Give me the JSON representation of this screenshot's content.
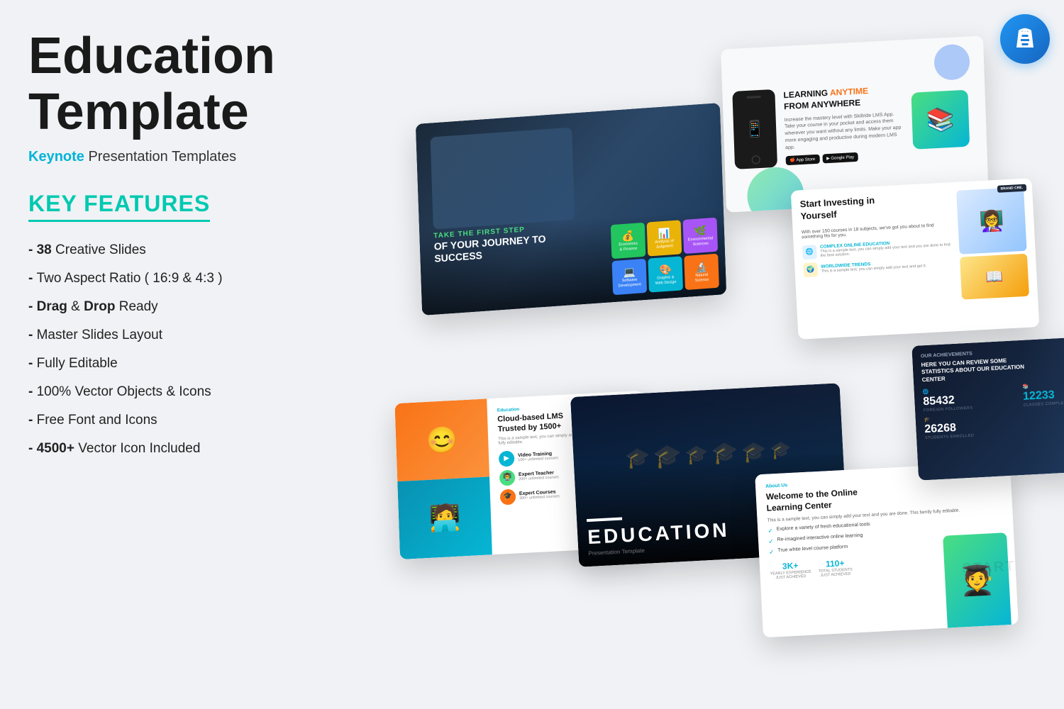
{
  "page": {
    "background": "#eef0f4",
    "title": "Education Template",
    "subtitle_prefix": "Keynote",
    "subtitle_suffix": " Presentation Templates",
    "features_heading": "KEY FEATURES",
    "features": [
      {
        "bold_part": "38",
        "rest": " Creative Slides"
      },
      {
        "bold_part": "",
        "rest": "Two Aspect Ratio ( 16:9 & 4:3 )"
      },
      {
        "bold_part": "Drag",
        "rest": " & ",
        "bold2": "Drop",
        "rest2": " Ready"
      },
      {
        "bold_part": "",
        "rest": "Master Slides Layout"
      },
      {
        "bold_part": "",
        "rest": "Fully Editable"
      },
      {
        "bold_part": "",
        "rest": "100% Vector Objects & Icons"
      },
      {
        "bold_part": "",
        "rest": "Free Font and Icons"
      },
      {
        "bold_part": "4500+",
        "rest": " Vector Icon Included"
      }
    ]
  },
  "slides": {
    "slide1": {
      "tagline": "TAKE THE FIRST STEP",
      "main": "OF YOUR JOURNEY TO SUCCESS",
      "boxes": [
        "Economics & Finance",
        "Analysis of Judgment",
        "Software Development",
        "Environmental Sciences",
        "Graphic Design"
      ]
    },
    "slide2": {
      "heading_highlight": "ANYTIME",
      "heading": "LEARNING ANYTIME FROM ANYWHERE",
      "body": "Increase the mastery level with Skillride LMS App. Take your course in your pocket and access them wherever you want without any limits.",
      "btn1": "App Store",
      "btn2": "Google Play"
    },
    "slide3": {
      "heading": "Start Investing in Yourself",
      "items": [
        "COMPLEX ONLINE EDUCATION",
        "WORLDWIDE TRENDS",
        "BRAND CRE"
      ]
    },
    "slide4": {
      "heading": "Cloud-based LMS Trusted by 1500+",
      "body": "This is a sample text, you can fully edit.",
      "items": [
        "Video Training",
        "Expert Teacher",
        "Expert Courses"
      ]
    },
    "slide5": {
      "heading": "EDUCATION",
      "sub": "Presentation Template"
    },
    "slide6": {
      "tag": "About Us",
      "heading": "Welcome to the Online Learning Center",
      "items": [
        "Explore a variety of fresh educational tools",
        "Re-imagined interactive online learning",
        "True white level course platform"
      ],
      "stats": [
        {
          "num": "3K+",
          "lbl": "YEARLY EXPERIENCE"
        },
        {
          "num": "110+",
          "lbl": "TOTAL STUDENTS"
        }
      ]
    },
    "slide7": {
      "tag": "OUR ACHIEVEMENTS",
      "desc": "HERE YOU CAN REVIEW SOME STATISTICS ABOUT OUR EDUCATION CENTER",
      "stats": [
        {
          "num": "85432",
          "lbl": "FOREIGN FOLLOWERS"
        },
        {
          "num": "12233",
          "lbl": "CLASSES COMPLETE"
        },
        {
          "num": "26268",
          "lbl": "STUDENTS ENROLLED"
        }
      ]
    }
  },
  "icons": {
    "keynote": "keynote-icon",
    "phone": "📱",
    "book": "📚",
    "graduate": "🎓",
    "person": "👤",
    "chart": "📊",
    "check": "✓",
    "star": "★"
  }
}
